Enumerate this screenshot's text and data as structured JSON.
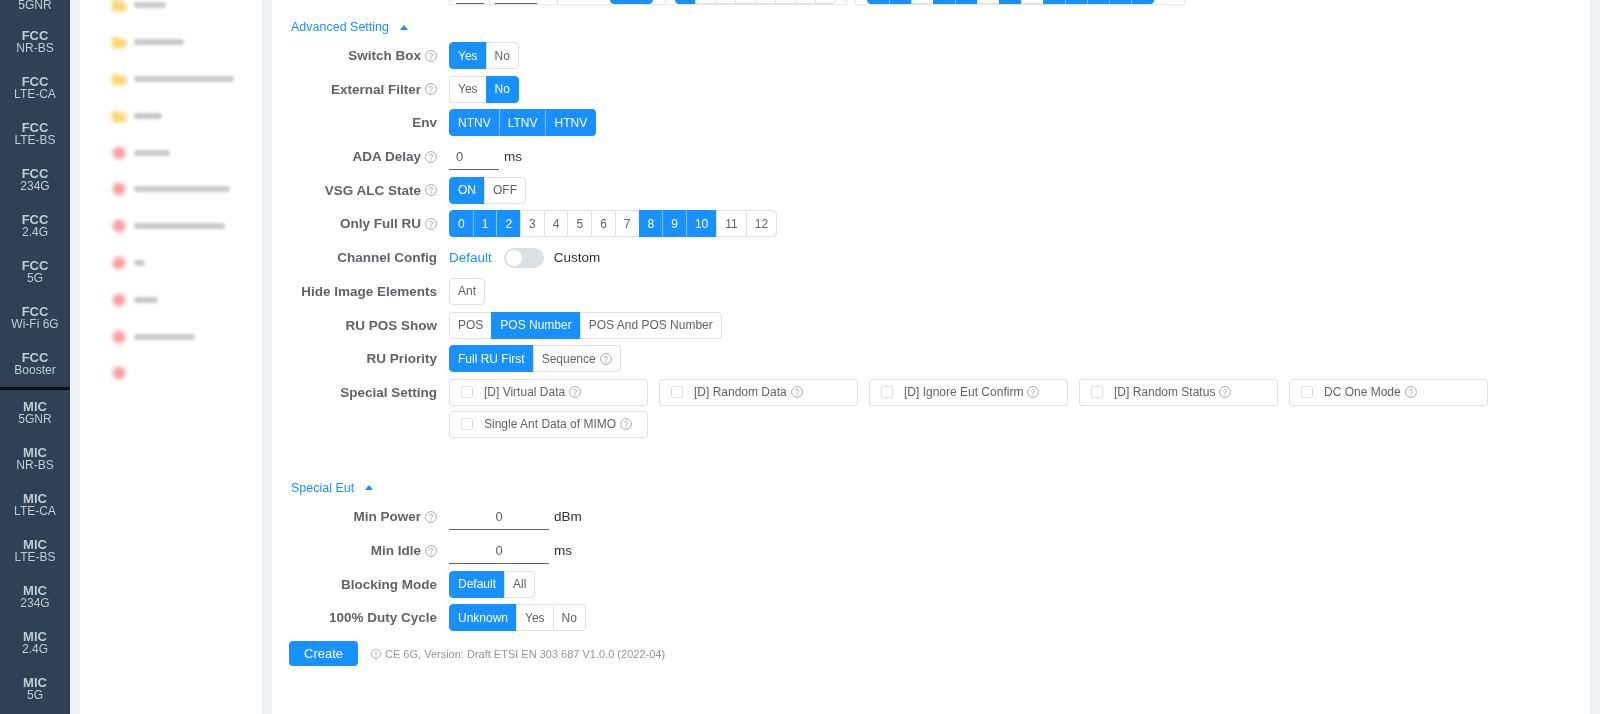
{
  "nav": {
    "groups": [
      {
        "items": [
          {
            "subtitle": "5GNR",
            "selected": false
          },
          {
            "title": "FCC",
            "subtitle": "NR-BS",
            "selected": false
          },
          {
            "title": "FCC",
            "subtitle": "LTE-CA",
            "selected": false
          },
          {
            "title": "FCC",
            "subtitle": "LTE-BS",
            "selected": false
          },
          {
            "title": "FCC",
            "subtitle": "234G",
            "selected": false
          },
          {
            "title": "FCC",
            "subtitle": "2.4G",
            "selected": false
          },
          {
            "title": "FCC",
            "subtitle": "5G",
            "selected": false
          },
          {
            "title": "FCC",
            "subtitle": "Wi-Fi 6G",
            "selected": false
          },
          {
            "title": "FCC",
            "subtitle": "Booster",
            "selected": false
          }
        ]
      },
      {
        "items": [
          {
            "title": "MIC",
            "subtitle": "5GNR",
            "selected": false
          },
          {
            "title": "MIC",
            "subtitle": "NR-BS",
            "selected": false
          },
          {
            "title": "MIC",
            "subtitle": "LTE-CA",
            "selected": false
          },
          {
            "title": "MIC",
            "subtitle": "LTE-BS",
            "selected": false
          },
          {
            "title": "MIC",
            "subtitle": "234G",
            "selected": false
          },
          {
            "title": "MIC",
            "subtitle": "2.4G",
            "selected": false
          },
          {
            "title": "MIC",
            "subtitle": "5G",
            "selected": false
          }
        ]
      }
    ]
  },
  "tree": {
    "items": [
      {
        "kind": "folder"
      },
      {
        "kind": "folder"
      },
      {
        "kind": "folder"
      },
      {
        "kind": "folder"
      },
      {
        "kind": "file"
      },
      {
        "kind": "file"
      },
      {
        "kind": "file"
      },
      {
        "kind": "file"
      },
      {
        "kind": "file"
      },
      {
        "kind": "file"
      },
      {
        "kind": "file"
      }
    ]
  },
  "cut_off_row": {
    "cells": [
      {
        "kind": "field"
      },
      {
        "kind": "field"
      },
      {
        "kind": "options",
        "options": [
          {
            "selected": true
          }
        ]
      },
      {
        "kind": "options",
        "options": [
          {
            "selected": true
          },
          {
            "selected": false
          },
          {
            "selected": false
          },
          {
            "selected": false
          },
          {
            "selected": false
          },
          {
            "selected": false
          },
          {
            "selected": false
          },
          {
            "selected": false
          }
        ]
      },
      {
        "kind": "options",
        "options": [
          {
            "selected": true
          },
          {
            "selected": true
          },
          {
            "selected": false
          },
          {
            "selected": true
          },
          {
            "selected": true
          },
          {
            "selected": false
          },
          {
            "selected": true
          },
          {
            "selected": false
          },
          {
            "selected": true
          },
          {
            "selected": true
          },
          {
            "selected": true
          },
          {
            "selected": true
          },
          {
            "selected": true
          }
        ]
      }
    ]
  },
  "sections": [
    {
      "title": "Advanced Setting",
      "expanded": true,
      "rows": [
        {
          "kind": "buttons",
          "label": "Switch Box",
          "help": true,
          "options": [
            {
              "label": "Yes",
              "selected": true
            },
            {
              "label": "No",
              "selected": false
            }
          ]
        },
        {
          "kind": "buttons",
          "label": "External Filter",
          "help": true,
          "options": [
            {
              "label": "Yes",
              "selected": false
            },
            {
              "label": "No",
              "selected": true
            }
          ]
        },
        {
          "kind": "buttons",
          "label": "Env",
          "help": false,
          "options": [
            {
              "label": "NTNV",
              "selected": true
            },
            {
              "label": "LTNV",
              "selected": true
            },
            {
              "label": "HTNV",
              "selected": true
            }
          ]
        },
        {
          "kind": "input",
          "label": "ADA Delay",
          "help": true,
          "value": "0",
          "unit": "ms"
        },
        {
          "kind": "buttons",
          "label": "VSG ALC State",
          "help": true,
          "options": [
            {
              "label": "ON",
              "selected": true
            },
            {
              "label": "OFF",
              "selected": false
            }
          ]
        },
        {
          "kind": "buttons",
          "label": "Only Full RU",
          "help": true,
          "options": [
            {
              "label": "0",
              "selected": true
            },
            {
              "label": "1",
              "selected": true
            },
            {
              "label": "2",
              "selected": true
            },
            {
              "label": "3",
              "selected": false
            },
            {
              "label": "4",
              "selected": false
            },
            {
              "label": "5",
              "selected": false
            },
            {
              "label": "6",
              "selected": false
            },
            {
              "label": "7",
              "selected": false
            },
            {
              "label": "8",
              "selected": true
            },
            {
              "label": "9",
              "selected": true
            },
            {
              "label": "10",
              "selected": true
            },
            {
              "label": "11",
              "selected": false
            },
            {
              "label": "12",
              "selected": false
            }
          ]
        },
        {
          "kind": "switch",
          "label": "Channel Config",
          "help": false,
          "off_label": "Default",
          "on_label": "Custom",
          "on": false
        },
        {
          "kind": "buttons",
          "label": "Hide Image Elements",
          "help": false,
          "options": [
            {
              "label": "Ant",
              "selected": false
            }
          ]
        },
        {
          "kind": "buttons",
          "label": "RU POS Show",
          "help": false,
          "options": [
            {
              "label": "POS",
              "selected": false
            },
            {
              "label": "POS Number",
              "selected": true
            },
            {
              "label": "POS And POS Number",
              "selected": false
            }
          ]
        },
        {
          "kind": "buttons",
          "label": "RU Priority",
          "help": false,
          "options": [
            {
              "label": "Full RU First",
              "selected": true
            },
            {
              "label": "Sequence",
              "selected": false,
              "help": true
            }
          ]
        },
        {
          "kind": "checkboxes",
          "label": "Special Setting",
          "help": false,
          "options": [
            {
              "label": "[D] Virtual Data",
              "help": true,
              "checked": false
            },
            {
              "label": "[D] Random Data",
              "help": true,
              "checked": false
            },
            {
              "label": "[D] Ignore Eut Confirm",
              "help": true,
              "checked": false
            },
            {
              "label": "[D] Random Status",
              "help": true,
              "checked": false
            },
            {
              "label": "DC One Mode",
              "help": true,
              "checked": false
            },
            {
              "label": "Single Ant Data of MIMO",
              "help": true,
              "checked": false
            }
          ]
        }
      ]
    },
    {
      "title": "Special Eut",
      "expanded": true,
      "rows": [
        {
          "kind": "number_input",
          "label": "Min Power",
          "help": true,
          "value": "0",
          "unit": "dBm"
        },
        {
          "kind": "number_input",
          "label": "Min Idle",
          "help": true,
          "value": "0",
          "unit": "ms"
        },
        {
          "kind": "buttons",
          "label": "Blocking Mode",
          "help": false,
          "options": [
            {
              "label": "Default",
              "selected": true
            },
            {
              "label": "All",
              "selected": false
            }
          ]
        },
        {
          "kind": "buttons",
          "label": "100% Duty Cycle",
          "help": false,
          "options": [
            {
              "label": "Unknown",
              "selected": true
            },
            {
              "label": "Yes",
              "selected": false
            },
            {
              "label": "No",
              "selected": false
            }
          ]
        }
      ]
    }
  ],
  "create_button": "Create",
  "version_note": "CE 6G, Version: Draft ETSI EN 303 687 V1.0.0 (2022-04)"
}
